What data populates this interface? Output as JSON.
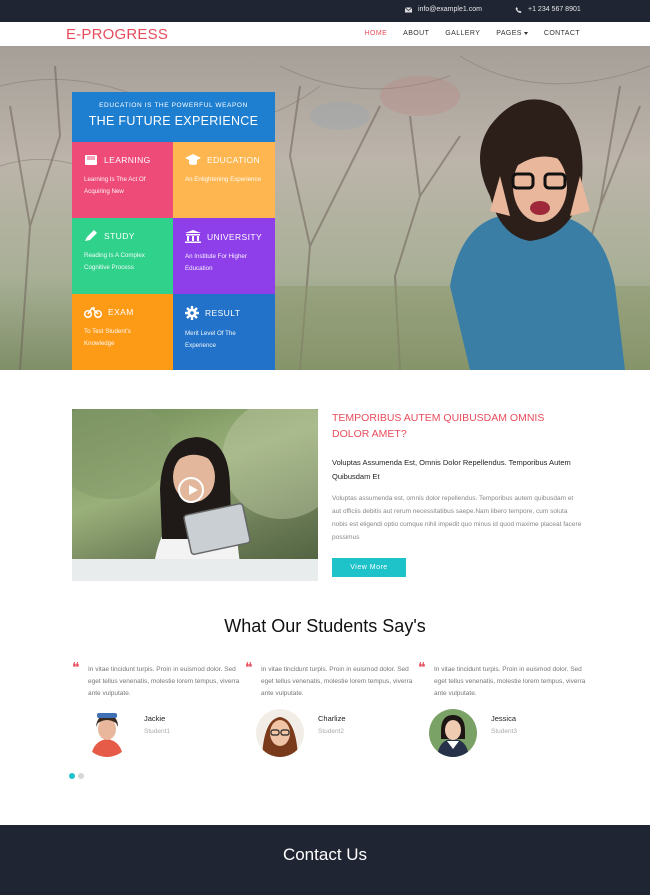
{
  "topbar": {
    "email": "info@example1.com",
    "phone": "+1 234 567 8901",
    "email_icon": "envelope-icon",
    "phone_icon": "phone-icon"
  },
  "nav": {
    "logo": "E-PROGRESS",
    "items": [
      "HOME",
      "ABOUT",
      "GALLERY",
      "PAGES",
      "CONTACT"
    ],
    "active": "HOME"
  },
  "hero": {
    "subtitle": "EDUCATION IS THE POWERFUL WEAPON",
    "title": "THE FUTURE EXPERIENCE",
    "tiles": [
      {
        "title": "LEARNING",
        "desc": "Learning Is The Act Of Acquiring New",
        "icon": "book-icon",
        "color": "#ee4b78"
      },
      {
        "title": "EDUCATION",
        "desc": "An Enlightening Experience",
        "icon": "graduation-cap-icon",
        "color": "#fdb650"
      },
      {
        "title": "STUDY",
        "desc": "Reading Is A Complex Cognitive Process",
        "icon": "pencil-icon",
        "color": "#2fd18b"
      },
      {
        "title": "UNIVERSITY",
        "desc": "An Institute For Higher Education",
        "icon": "institution-icon",
        "color": "#8e3fea"
      },
      {
        "title": "EXAM",
        "desc": "To Test Student's Knowledge",
        "icon": "bicycle-icon",
        "color": "#fd9a16"
      },
      {
        "title": "RESULT",
        "desc": "Merit Level Of The Experience",
        "icon": "gear-icon",
        "color": "#2172c8"
      }
    ]
  },
  "about": {
    "title": "TEMPORIBUS AUTEM QUIBUSDAM OMNIS DOLOR AMET?",
    "subtitle": "Voluptas Assumenda Est, Omnis Dolor Repellendus. Temporibus Autem Quibusdam Et",
    "body": "Voluptas assumenda est, omnis dolor repellendus. Temporibus autem quibusdam et aut officiis debitis aut rerum necessitatibus saepe.Nam libero tempore, cum soluta nobis est eligendi optio cumque nihil impedit quo minus id quod maxime placeat facere possimus",
    "button": "View More"
  },
  "testimonials": {
    "title": "What Our Students Say's",
    "items": [
      {
        "text": "In vitae tincidunt turpis. Proin in euismod dolor. Sed eget tellus venenatis, molestie lorem tempus, viverra ante vulputate.",
        "name": "Jackie",
        "role": "Student1"
      },
      {
        "text": "In vitae tincidunt turpis. Proin in euismod dolor. Sed eget tellus venenatis, molestie lorem tempus, viverra ante vulputate.",
        "name": "Charlize",
        "role": "Student2"
      },
      {
        "text": "In vitae tincidunt turpis. Proin in euismod dolor. Sed eget tellus venenatis, molestie lorem tempus, viverra ante vulputate.",
        "name": "Jessica",
        "role": "Student3"
      }
    ],
    "active_dot": 0
  },
  "footer": {
    "title": "Contact Us"
  }
}
